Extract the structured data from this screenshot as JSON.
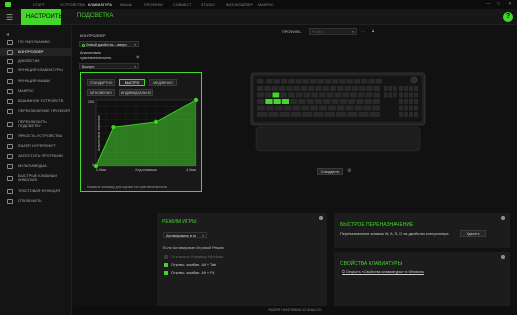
{
  "topbar": {
    "items": [
      "СТАРТ",
      "УСТРОЙСТВА",
      "КЛАВИАТУРА",
      "МЫШЬ",
      "ПРОФИЛИ",
      "CONNECT",
      "STUDIO",
      "ВИЗУАЛАЙЗЕР",
      "МАКРОС"
    ],
    "active_index": 2,
    "window_controls": [
      "—",
      "□",
      "✕"
    ]
  },
  "subbar": {
    "tabs": [
      "НАСТРОИТЬ",
      "ПОДСВЕТКА"
    ],
    "active_index": 0,
    "help": "?"
  },
  "sidebar": {
    "items": [
      {
        "label": "ПО УМОЛЧАНИЮ",
        "active": false
      },
      {
        "label": "КОНТРОЛЛЕР",
        "active": true
      },
      {
        "label": "ДЖОЙСТИК",
        "active": false
      },
      {
        "label": "ФУНКЦИЯ КЛАВИАТУРЫ",
        "active": false
      },
      {
        "label": "ФУНКЦИЯ МЫШИ",
        "active": false
      },
      {
        "label": "МАКРОС",
        "active": false
      },
      {
        "label": "ВЗАИМНОЕ УСТРОЙСТВ",
        "active": false
      },
      {
        "label": "ПЕРЕКЛЮЧЕНИЕ ПРОФИЛЯ",
        "active": false
      },
      {
        "label": "ПЕРЕКЛЮЧИТЬ\nПОДСВЕТКУ",
        "active": false
      },
      {
        "label": "ЯРКОСТЬ УСТРОЙСТВА",
        "active": false
      },
      {
        "label": "RAZER HYPERSHIFT",
        "active": false
      },
      {
        "label": "ЗАПУСТИТЬ ПРОГРАММ",
        "active": false
      },
      {
        "label": "МУЛЬТИМЕДИА",
        "active": false
      },
      {
        "label": "БЫСТРЫЕ КЛАВИШИ\nWINDOWS",
        "active": false
      },
      {
        "label": "ТЕКСТОВАЯ ФУНКЦИЯ",
        "active": false
      },
      {
        "label": "ОТКЛЮЧИТЬ",
        "active": false
      }
    ]
  },
  "controller": {
    "section_label": "КОНТРОЛЛЕР",
    "dropdown_value": "Левый джойстик – вверх",
    "analog_label": "Аналоговая\nчувствительность",
    "speed_value": "Быстро"
  },
  "popup": {
    "buttons_row1": [
      "СТАНДАРТНО",
      "БЫСТРО",
      "МЕДЛЕННО"
    ],
    "buttons_row2": [
      "МГНОВЕННО",
      "ИНДИВИДУАЛЬНО"
    ],
    "selected": "БЫСТРО",
    "hint": "Нажмите клавишу для оценки его чувствительности"
  },
  "chart_data": {
    "type": "area",
    "xlabel": "Ход клавиши",
    "ylabel": "Аналоговое значение",
    "x_tick_labels": [
      "0,0мм",
      "4,0мм"
    ],
    "y_tick_labels": [
      "255",
      "0"
    ],
    "x": [
      0.0,
      0.7,
      2.4,
      4.0
    ],
    "values": [
      0,
      150,
      170,
      255
    ],
    "xlim": [
      0,
      4.0
    ],
    "ylim": [
      0,
      255
    ],
    "grid": true
  },
  "profile": {
    "label": "ПРОФИЛЬ",
    "value": "Profile 1"
  },
  "keyboard": {
    "standard_button": "Стандартно"
  },
  "game_mode": {
    "title": "РЕЖИМ ИГРЫ",
    "dropdown": "Активировать в иг",
    "enable_text": "Если Активирован Игровой Режим",
    "options": [
      {
        "label": "Отключить Клавишу Windows",
        "checked": false
      },
      {
        "label": "Отключ. комбин. Alt + Tab",
        "checked": true
      },
      {
        "label": "Отключ. комбин. Alt + F4",
        "checked": true
      }
    ]
  },
  "quick_remap": {
    "title": "БЫСТРОЕ ПЕРЕНАЗНАЧЕНИЕ",
    "text": "Переназначение клавиш W, A, S, D на джойстик контроллера",
    "button": "Удалить"
  },
  "keyboard_props": {
    "title": "СВОЙСТВА КЛАВИАТУРЫ",
    "link": "Открыть «Свойства клавиатуры» в Windows"
  },
  "statusbar": {
    "text": "RAZER HUNTSMAN V2 ANALOG"
  },
  "colors": {
    "accent": "#44d62c"
  }
}
